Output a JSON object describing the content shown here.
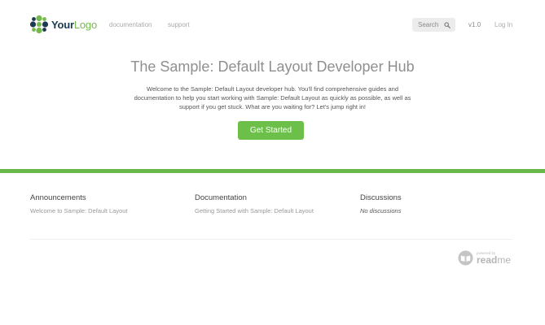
{
  "header": {
    "logo": {
      "word_bold": "Your",
      "word_accent": "Logo"
    },
    "nav": [
      {
        "label": "documentation"
      },
      {
        "label": "support"
      }
    ],
    "search_label": "Search",
    "version": "v1.0",
    "login": "Log In"
  },
  "hero": {
    "title": "The Sample: Default Layout Developer Hub",
    "intro": "Welcome to the Sample: Default Layout developer hub. You'll find comprehensive guides and documentation to help you start working with Sample: Default Layout as quickly as possible, as well as support if you get stuck. What are you waiting for? Let's jump right in!",
    "cta": "Get Started"
  },
  "sections": {
    "announcements": {
      "title": "Announcements",
      "link": "Welcome to Sample: Default Layout"
    },
    "documentation": {
      "title": "Documentation",
      "link": "Getting Started with Sample: Default Layout"
    },
    "discussions": {
      "title": "Discussions",
      "empty": "No discussions"
    }
  },
  "footer": {
    "powered_by": "powered by",
    "brand_bold": "read",
    "brand_thin": "me"
  },
  "colors": {
    "accent_green": "#6cc04a",
    "logo_navy": "#1d3b50"
  }
}
